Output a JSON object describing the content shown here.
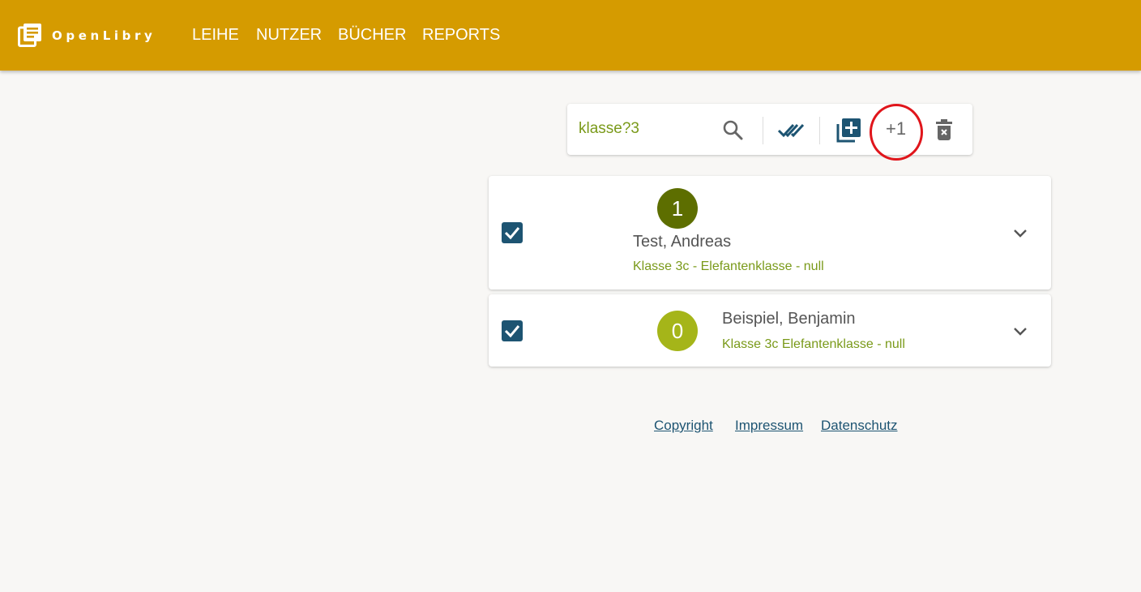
{
  "app": {
    "name": "OpenLibry",
    "brand_color": "#d59b00",
    "accent_color": "#1d5472"
  },
  "nav": [
    {
      "label": "LEIHE"
    },
    {
      "label": "NUTZER"
    },
    {
      "label": "BÜCHER"
    },
    {
      "label": "REPORTS"
    }
  ],
  "toolbar": {
    "search_value": "klasse?3",
    "search_icon": "search-icon",
    "select_all_icon": "double-check-icon",
    "add_icon": "library-add-icon",
    "increase_label": "+1",
    "delete_icon": "delete-icon"
  },
  "users": [
    {
      "count": "1",
      "name": "Test, Andreas",
      "details": "Klasse 3c - Elefantenklasse - null",
      "checked": true,
      "badge_color": "#5d6e00"
    },
    {
      "count": "0",
      "name": "Beispiel, Benjamin",
      "details": "Klasse 3c Elefantenklasse - null",
      "checked": true,
      "badge_color": "#a5b519"
    }
  ],
  "footer": {
    "copyright": "Copyright",
    "impressum": "Impressum",
    "datenschutz": "Datenschutz"
  }
}
